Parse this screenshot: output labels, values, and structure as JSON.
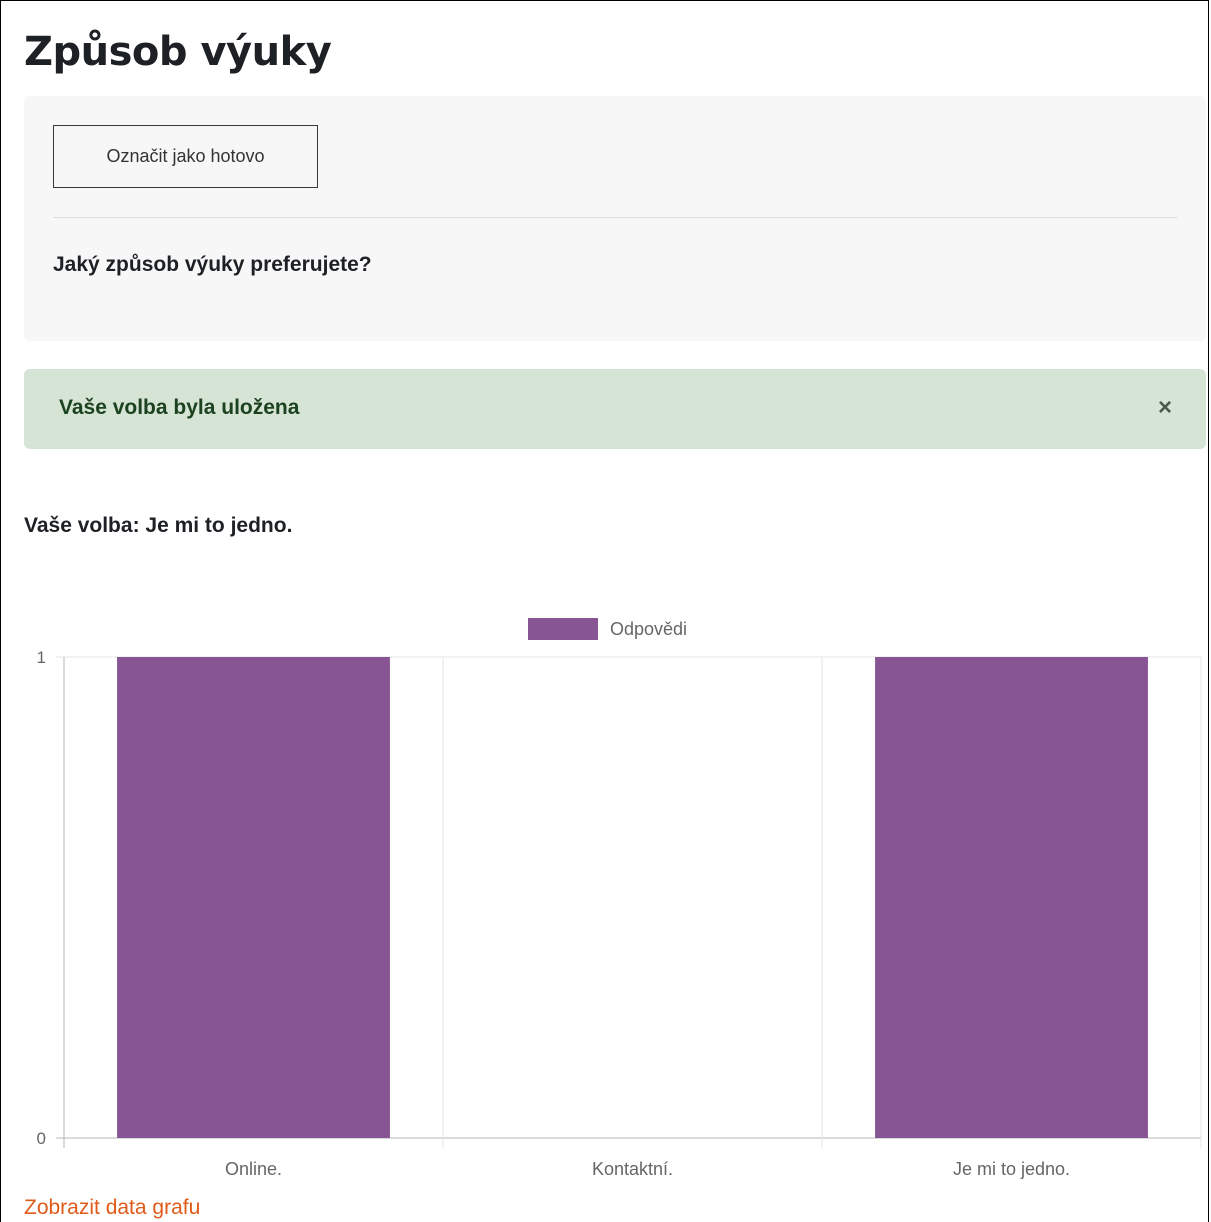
{
  "page": {
    "title": "Způsob výuky"
  },
  "activity": {
    "mark_done_label": "Označit jako hotovo",
    "question": "Jaký způsob výuky preferujete?"
  },
  "alert": {
    "message": "Vaše volba byla uložena",
    "close_label": "×"
  },
  "result": {
    "your_choice": "Vaše volba: Je mi to jedno."
  },
  "chart_link": "Zobrazit data grafu",
  "colors": {
    "bar": "#875593",
    "link": "#e05a1a",
    "alert_bg": "#d6e4d6"
  },
  "chart_data": {
    "type": "bar",
    "categories": [
      "Online.",
      "Kontaktní.",
      "Je mi to jedno."
    ],
    "series": [
      {
        "name": "Odpovědi",
        "values": [
          1,
          0,
          1
        ]
      }
    ],
    "ylim": [
      0,
      1
    ],
    "yticks": [
      "0",
      "1"
    ],
    "legend": "top-center",
    "grid": true
  }
}
